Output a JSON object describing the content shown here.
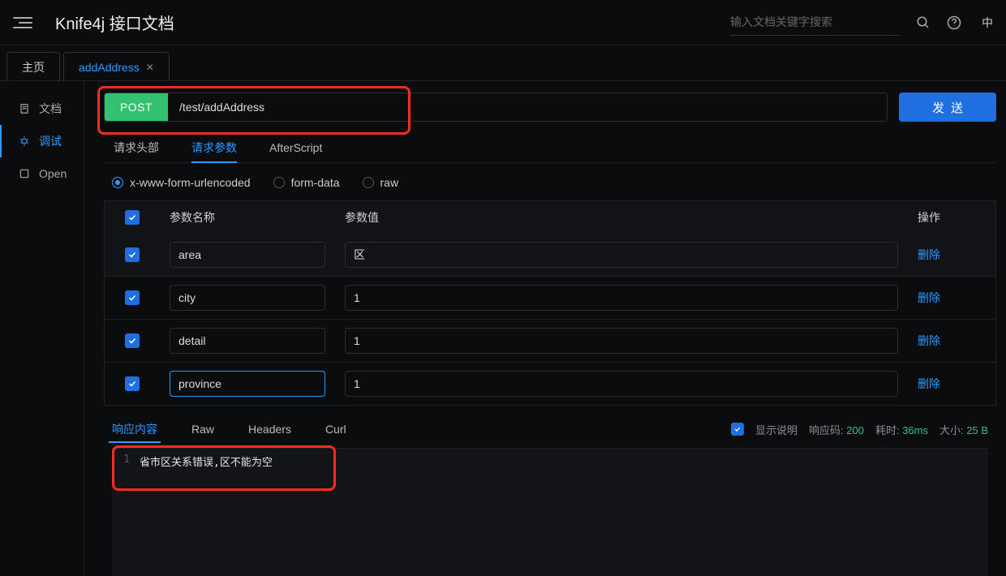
{
  "header": {
    "title": "Knife4j 接口文档",
    "search_placeholder": "输入文档关键字搜索",
    "lang": "中"
  },
  "page_tabs": [
    {
      "label": "主页",
      "active": false,
      "closable": false
    },
    {
      "label": "addAddress",
      "active": true,
      "closable": true
    }
  ],
  "sidebar": [
    {
      "icon": "doc-icon",
      "label": "文档",
      "active": false
    },
    {
      "icon": "debug-icon",
      "label": "调试",
      "active": true
    },
    {
      "icon": "open-icon",
      "label": "Open",
      "active": false
    }
  ],
  "api": {
    "method": "POST",
    "url": "/test/addAddress",
    "send_label": "发送"
  },
  "sub_tabs": [
    {
      "label": "请求头部",
      "active": false
    },
    {
      "label": "请求参数",
      "active": true
    },
    {
      "label": "AfterScript",
      "active": false
    }
  ],
  "body_types": [
    {
      "label": "x-www-form-urlencoded",
      "checked": true
    },
    {
      "label": "form-data",
      "checked": false
    },
    {
      "label": "raw",
      "checked": false
    }
  ],
  "param_table": {
    "headers": {
      "name": "参数名称",
      "value": "参数值",
      "action": "操作"
    },
    "rows": [
      {
        "checked": true,
        "name": "area",
        "value": "区",
        "focused": false
      },
      {
        "checked": true,
        "name": "city",
        "value": "1",
        "focused": false
      },
      {
        "checked": true,
        "name": "detail",
        "value": "1",
        "focused": false
      },
      {
        "checked": true,
        "name": "province",
        "value": "1",
        "focused": true
      }
    ],
    "delete_label": "删除"
  },
  "response": {
    "tabs": [
      {
        "label": "响应内容",
        "active": true
      },
      {
        "label": "Raw",
        "active": false
      },
      {
        "label": "Headers",
        "active": false
      },
      {
        "label": "Curl",
        "active": false
      }
    ],
    "show_desc_label": "显示说明",
    "show_desc_checked": true,
    "meta": {
      "code_label": "响应码:",
      "code_value": "200",
      "time_label": "耗时:",
      "time_value": "36ms",
      "size_label": "大小:",
      "size_value": "25 B"
    },
    "body_line_no": "1",
    "body_text": "省市区关系错误,区不能为空"
  }
}
